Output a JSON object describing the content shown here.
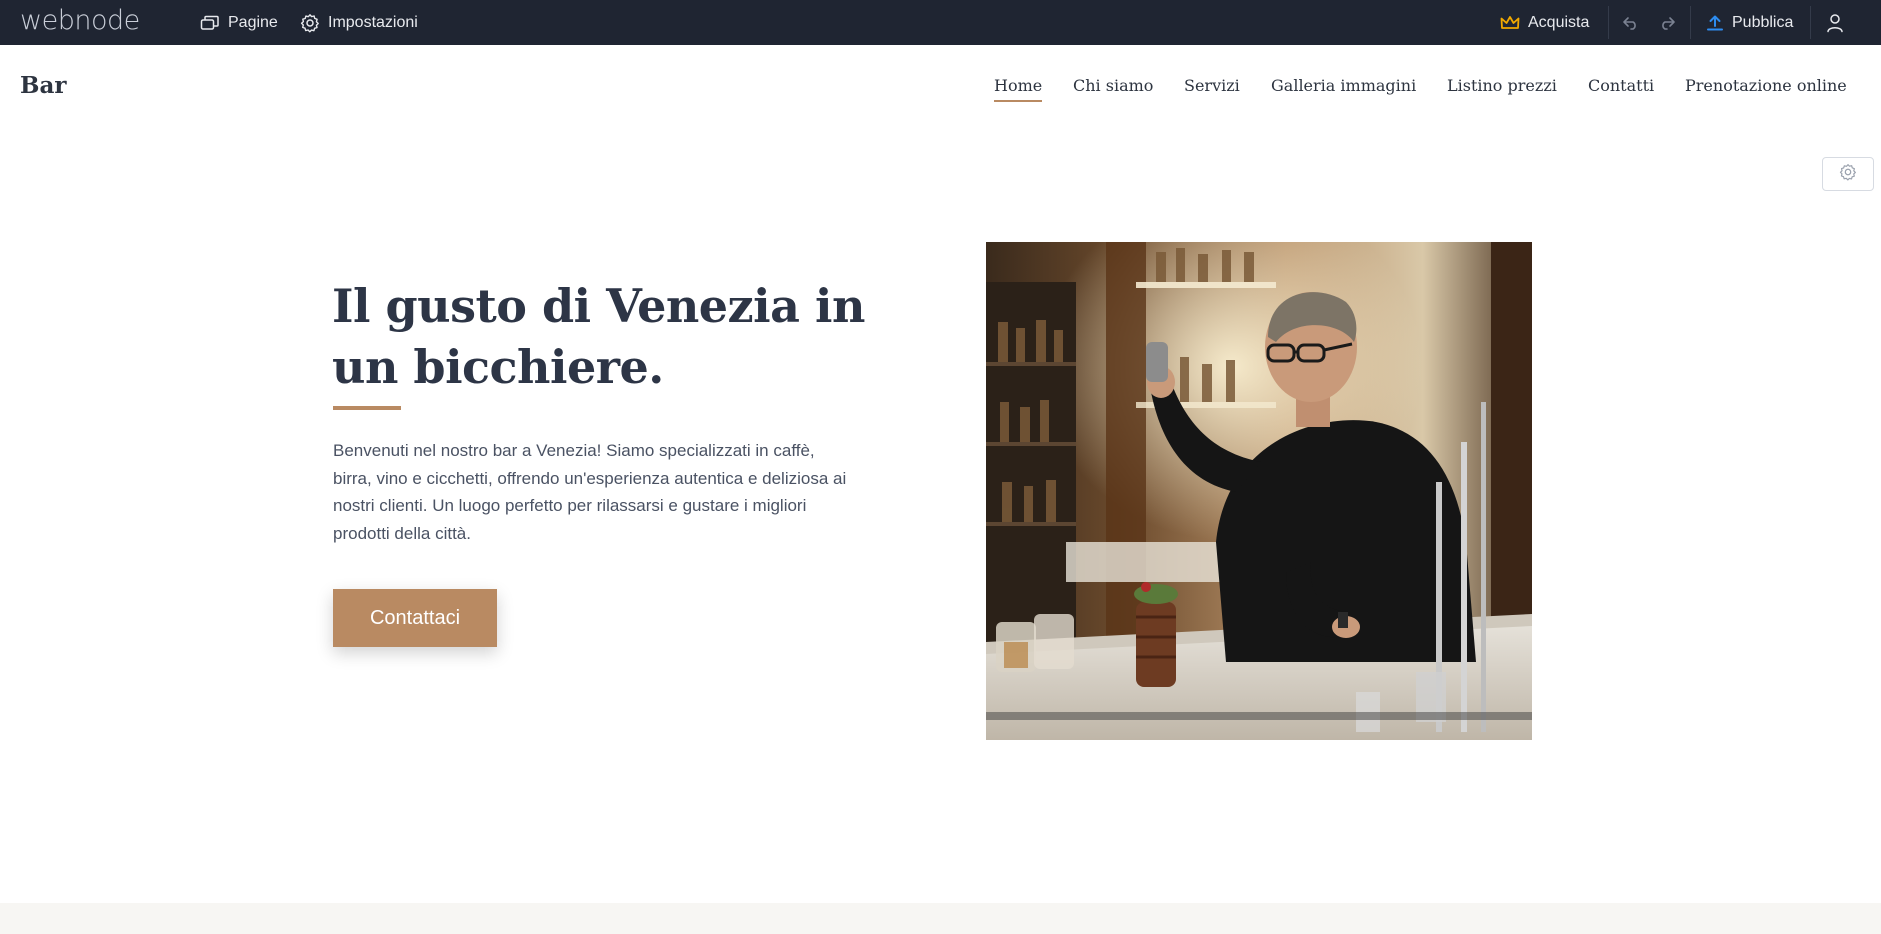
{
  "editor": {
    "logo": "webnode",
    "pages_label": "Pagine",
    "settings_label": "Impostazioni",
    "buy_label": "Acquista",
    "publish_label": "Pubblica"
  },
  "site": {
    "title": "Bar",
    "nav": [
      "Home",
      "Chi siamo",
      "Servizi",
      "Galleria immagini",
      "Listino prezzi",
      "Contatti",
      "Prenotazione online"
    ],
    "active_nav": "Home"
  },
  "hero": {
    "title": "Il gusto di Venezia in un bicchiere.",
    "text": "Benvenuti nel nostro bar a Venezia! Siamo specializzati in caffè, birra, vino e cicchetti, offrendo un'esperienza autentica e deliziosa ai nostri clienti. Un luogo perfetto per rilassarsi e gustare i migliori prodotti della città.",
    "button": "Contattaci"
  },
  "colors": {
    "toolbar_bg": "#1f2532",
    "accent": "#b98a62",
    "crown": "#f2a900",
    "publish_icon": "#2d8cf0",
    "heading": "#2d3546",
    "text": "#4a5263"
  },
  "icons": [
    "pages-icon",
    "gear-icon",
    "crown-icon",
    "undo-icon",
    "redo-icon",
    "upload-icon",
    "user-icon",
    "section-settings-gear-icon"
  ]
}
